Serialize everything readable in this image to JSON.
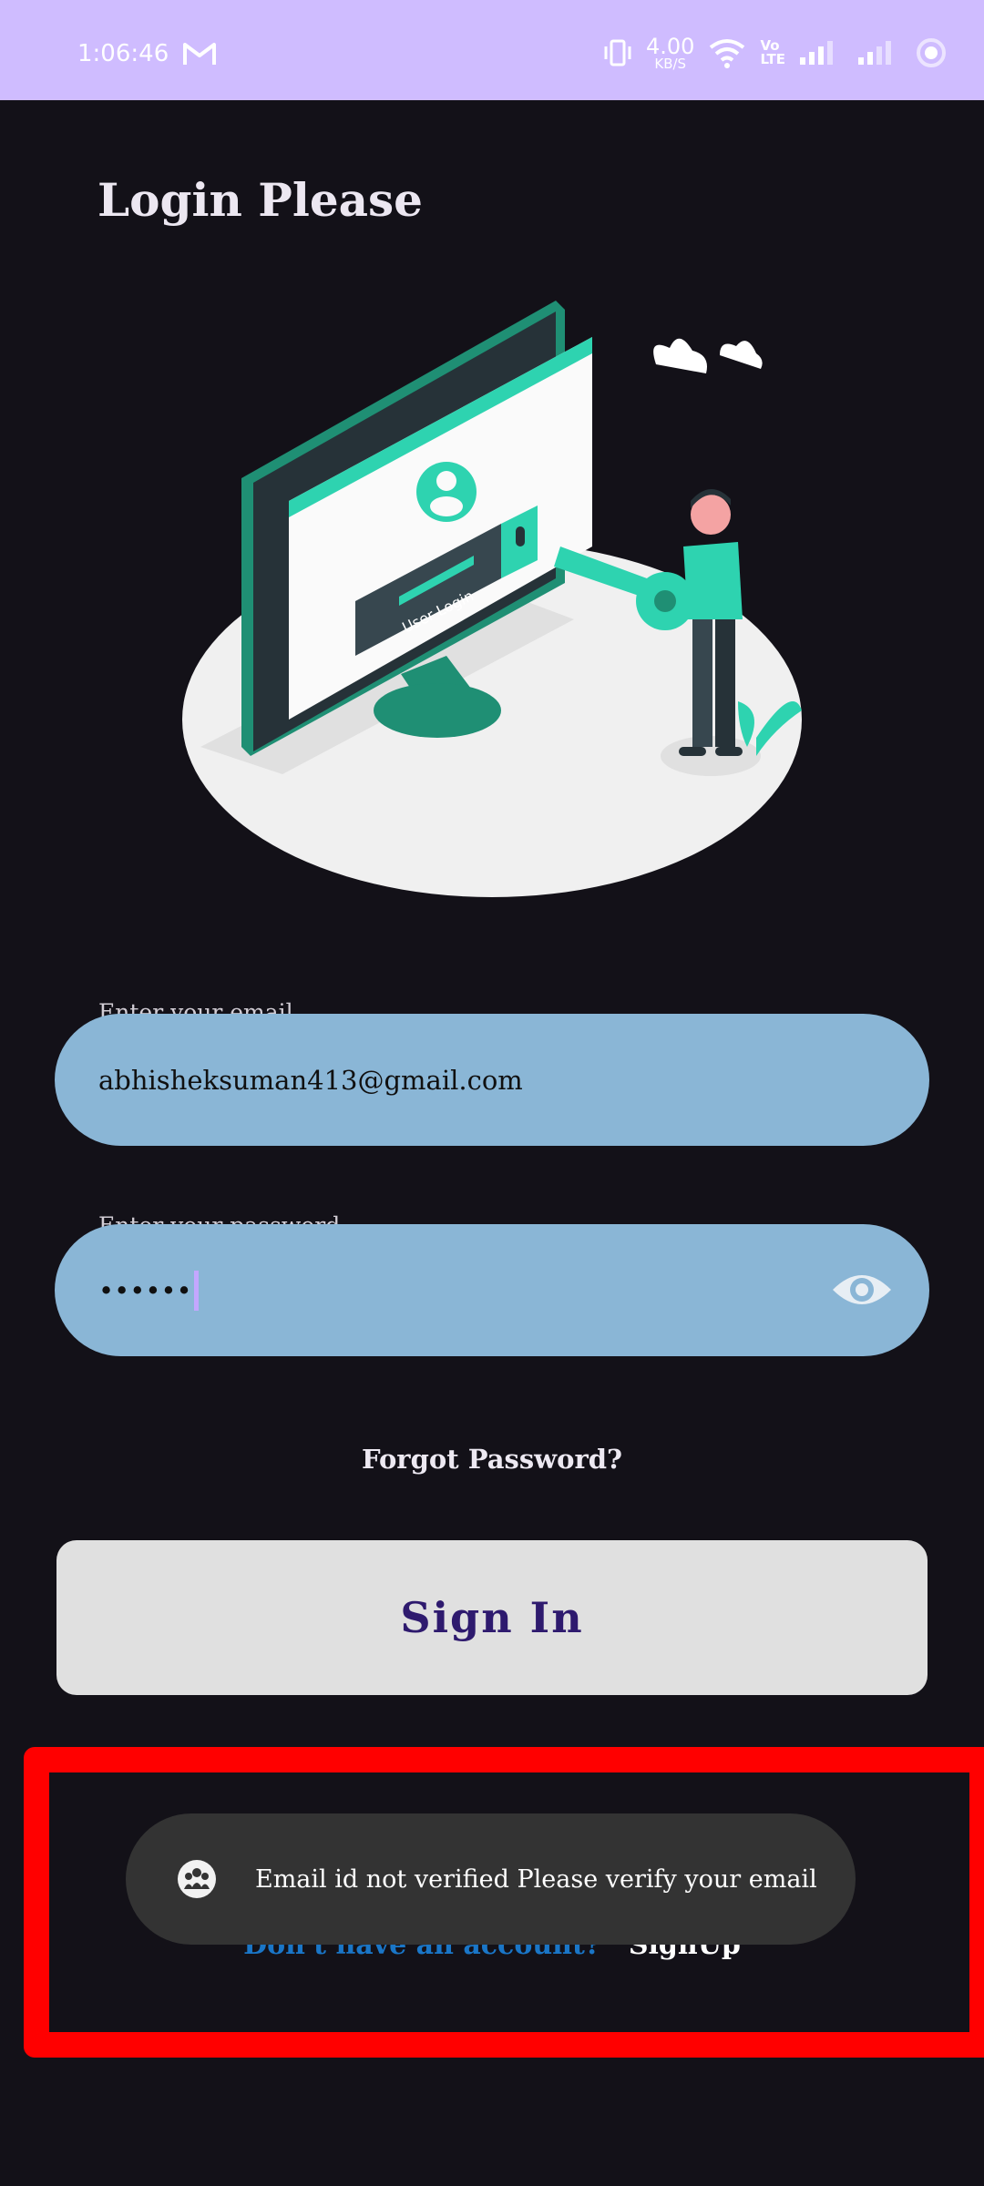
{
  "status_bar": {
    "time": "1:06:46",
    "speed_value": "4.00",
    "speed_unit": "KB/S",
    "volte_line1": "Vo",
    "volte_line2": "LTE",
    "icons": [
      "gmail-icon",
      "vibrate-icon",
      "wifi-icon",
      "signal-icon",
      "signal-icon",
      "battery-ring-icon"
    ]
  },
  "page": {
    "title": "Login Please"
  },
  "illustration": {
    "screen_text": "User Login"
  },
  "email": {
    "label": "Enter your email",
    "value": "abhisheksuman413@gmail.com"
  },
  "password": {
    "label": "Enter your password",
    "value": "••••••",
    "toggle_icon": "eye-icon"
  },
  "forgot_password": "Forgot Password?",
  "sign_in": "Sign In",
  "signup": {
    "question": "Don't have an account?",
    "link": "SignUp"
  },
  "toast": {
    "message": "Email id not verified Please verify your email",
    "icon": "app-logo-icon"
  },
  "colors": {
    "background": "#131118",
    "status_bar": "#cfbcff",
    "input": "#8ab6d6",
    "button": "#e0e0e0",
    "button_text": "#2e1a6e",
    "highlight": "#ff0000",
    "accent_teal": "#2ed3b0"
  }
}
